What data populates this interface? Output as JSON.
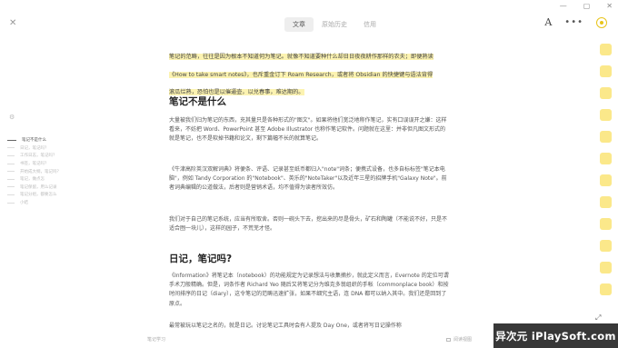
{
  "window": {
    "minimize": "—",
    "maximize": "▢",
    "close": "✕"
  },
  "topbar": {
    "close_label": "✕",
    "tabs": [
      {
        "label": "文章"
      },
      {
        "label": "原始历史"
      },
      {
        "label": "信用"
      }
    ],
    "font_icon_label": "A",
    "more_label": "•••"
  },
  "toc": {
    "gear_label": "⚙",
    "items": [
      {
        "label": "笔记不是什么"
      },
      {
        "label": "日记，笔记吗？"
      },
      {
        "label": "工作日志，笔记吗？"
      },
      {
        "label": "书签，笔记吗？"
      },
      {
        "label": "开始成大纲，笔记吗？"
      },
      {
        "label": "笔记，做点怎"
      },
      {
        "label": "笔记保留，用么记录"
      },
      {
        "label": "笔记分组，都要怎么"
      },
      {
        "label": "小结"
      }
    ]
  },
  "article": {
    "highlight": "笔记的范畴，往往是因为根本不知道何为笔记。就像不知道要种什么却日日夜夜耕作那样的农夫；即便熟读《How to take smart notes》，也斥重金订下 Roam Research，或者将 Obsidian 的快捷键与语法背得滚瓜烂熟，恐怕也是以催逼壶，以兑春事，难达期的。",
    "h2_1": "笔记不是什么",
    "p1": "大量被我们归为笔记的东西，充其量只是各种形式的\"图文\"。如果将他们宽泛地称作笔记，实有口误误开之嫌：这样看来，不妨把 Word、PowerPoint 甚至 Adobe Illustrator 也称作笔记软件。问题就在这里：并非但凡图文形式的就是笔记，也不是软掉书籍和论文，剩下篇幅不长的就算笔记。",
    "p2": "《牛津高阶英汉双解词典》将便条、评语、记录甚至纸币都归入\"note\"词条；便携式设备，也多自标标签\"笔记本电脑\"，例如 Tandy Corporation 的\"Notebook\"、英乐的\"NoteTaker\"以及近年三星的招牌手机\"Galaxy Note\"。前者词典编辑的公道做法，后者则是营销术语，均不值得为读者所效仿。",
    "p3": "我们对于自己的笔记系统，应当有所取舍。否则一碗头下去，挖出来的尽是骨头，矿石和陶罐（不能说不好，只是不适合囫一块儿），这样的园子，不荒芜才怪。",
    "h2_2": "日记，笔记吗?",
    "p4": "《Information》将笔记本（notebook）的功能规定为记录想法与收集摘抄，就此定义而言，Evernote 的定位可谓手术刀般精确。但是，词条作者 Richard Yeo 随后又将笔记分为维克多翁组织的手帐（commonplace book）和按时间排序的日记（diary），这令笔记的范畴迅速扩张，如果不细究主语，连 DNA 都可以纳入其中。我们还是回到了原点。",
    "p5": "最常被玩以笔记之名的，就是日记。讨论笔记工具时会有人提及 Day One，或者将写日记操作称"
  },
  "status": {
    "left": "笔记学习",
    "right": "阅读视图"
  },
  "resize_label": "⤢",
  "watermark": "异次元 iPlaySoft.com",
  "colors": {
    "highlight": "#fcf3b1",
    "sidebar_square": "#fbe88a",
    "accent": "#e8c41a"
  }
}
